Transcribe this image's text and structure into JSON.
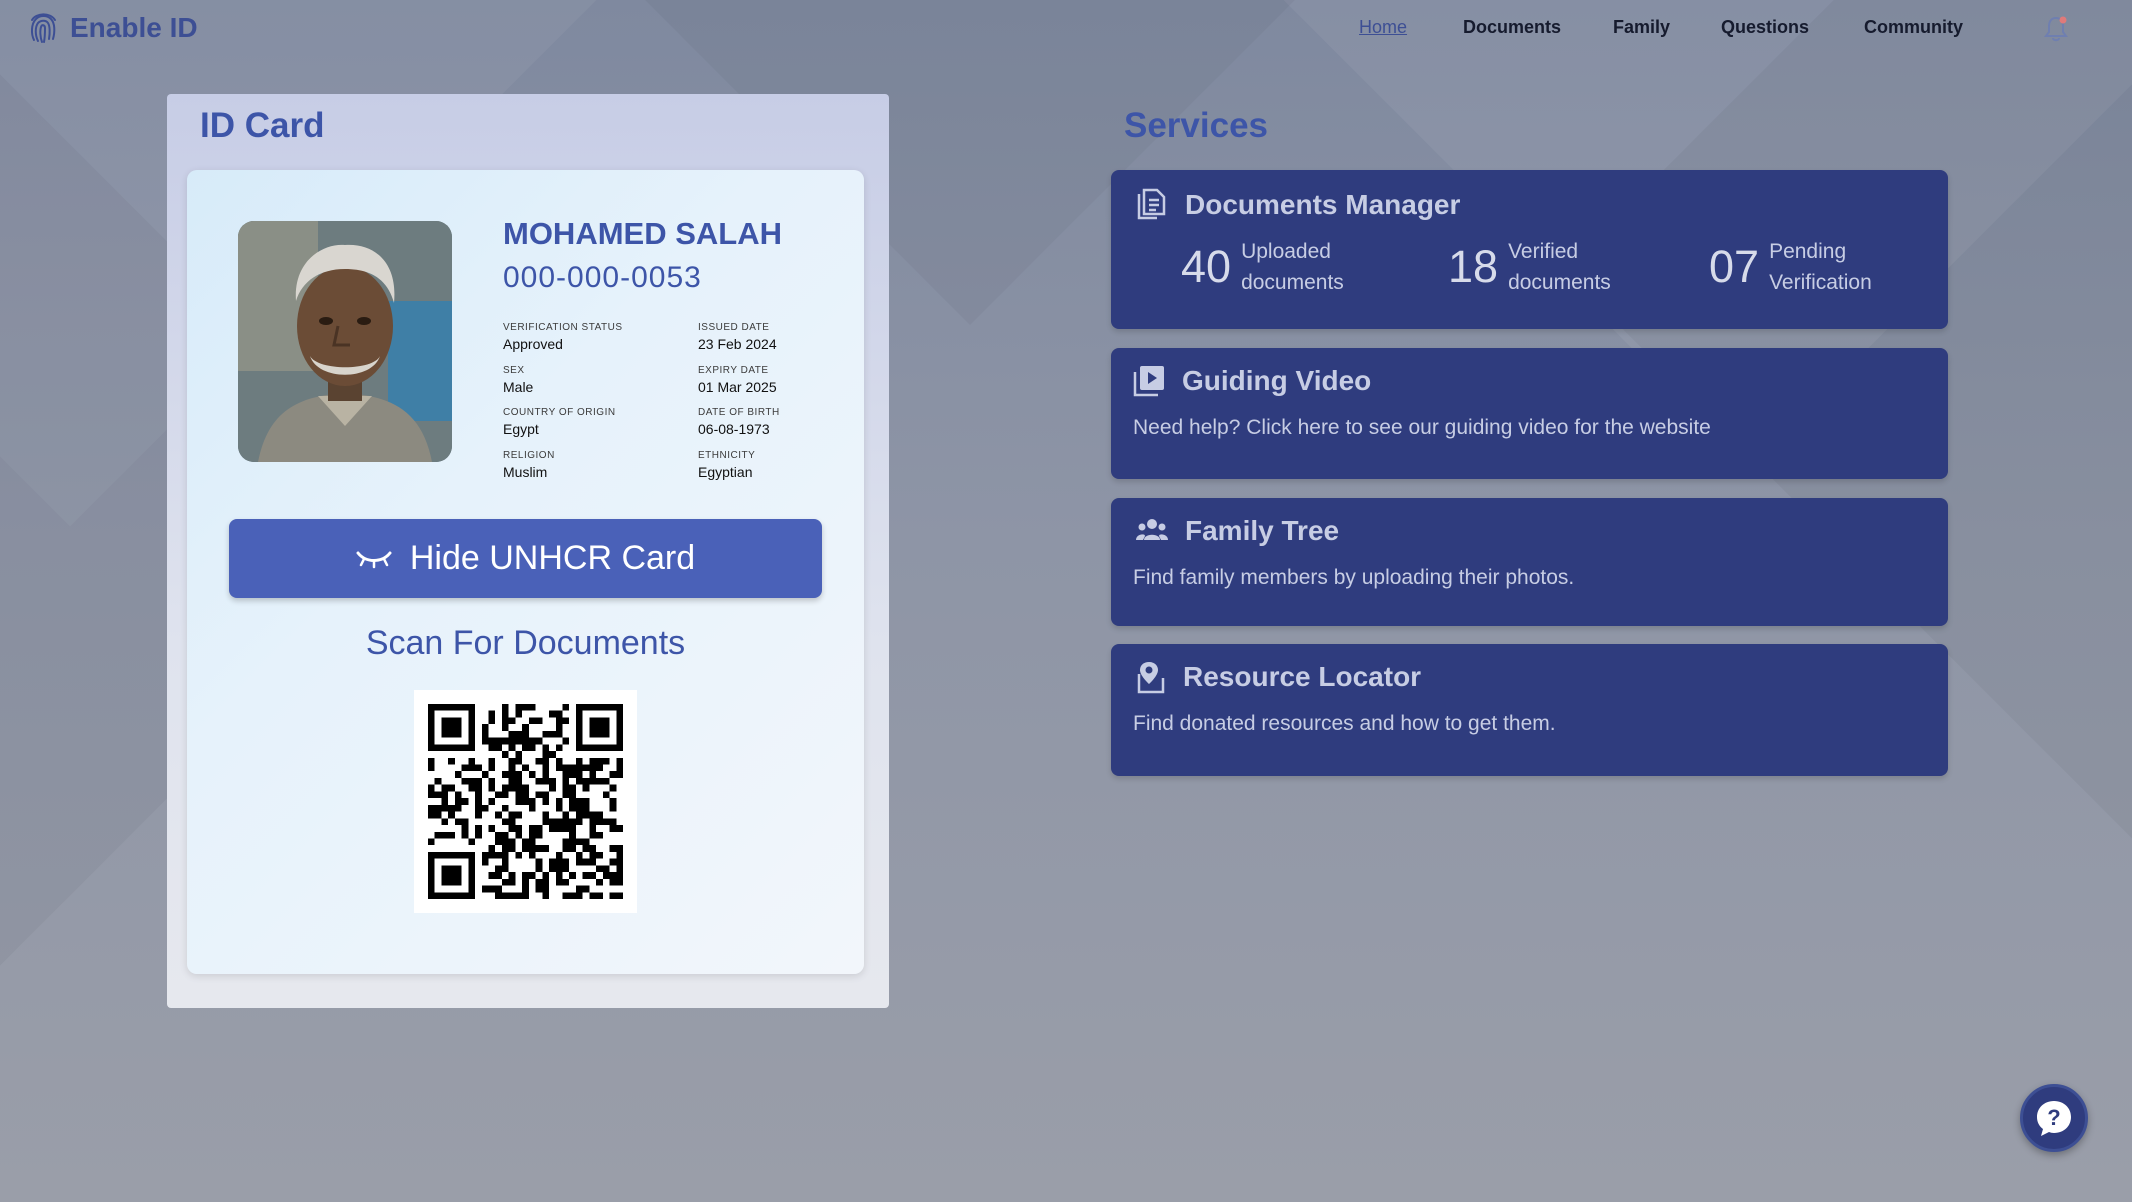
{
  "brand": {
    "name": "Enable ID",
    "logo_icon": "fingerprint-icon"
  },
  "nav": {
    "items": [
      {
        "label": "Home",
        "active": true
      },
      {
        "label": "Documents",
        "active": false
      },
      {
        "label": "Family",
        "active": false
      },
      {
        "label": "Questions",
        "active": false
      },
      {
        "label": "Community",
        "active": false
      }
    ],
    "notification_icon": "bell-icon"
  },
  "id_card": {
    "title": "ID Card",
    "name": "MOHAMED SALAH",
    "id_number": "000-000-0053",
    "fields": [
      {
        "label": "Verification Status",
        "value": "Approved"
      },
      {
        "label": "Issued Date",
        "value": "23 Feb 2024"
      },
      {
        "label": "Sex",
        "value": "Male"
      },
      {
        "label": "Expiry Date",
        "value": "01 Mar 2025"
      },
      {
        "label": "Country of Origin",
        "value": "Egypt"
      },
      {
        "label": "Date of Birth",
        "value": "06-08-1973"
      },
      {
        "label": "Religion",
        "value": "Muslim"
      },
      {
        "label": "Ethnicity",
        "value": "Egyptian"
      }
    ],
    "hide_button_label": "Hide UNHCR Card",
    "hide_button_icon": "eye-closed-icon",
    "scan_title": "Scan For Documents"
  },
  "services": {
    "title": "Services",
    "documents_manager": {
      "title": "Documents Manager",
      "icon": "documents-icon",
      "stats": [
        {
          "value": "40",
          "label": "Uploaded documents"
        },
        {
          "value": "18",
          "label": "Verified documents"
        },
        {
          "value": "07",
          "label": "Pending Verification"
        }
      ]
    },
    "guiding_video": {
      "title": "Guiding Video",
      "icon": "video-play-icon",
      "description": "Need help? Click here to see our guiding video for the website"
    },
    "family_tree": {
      "title": "Family Tree",
      "icon": "people-icon",
      "description": "Find family members by uploading their photos."
    },
    "resource_locator": {
      "title": "Resource Locator",
      "icon": "map-pin-icon",
      "description": "Find donated resources and how to get them."
    }
  },
  "help_button": {
    "label": "?",
    "icon": "help-chat-icon"
  },
  "colors": {
    "primary": "#3d55a8",
    "card_dark": "#2f3c7e",
    "button": "#4a61b8"
  }
}
